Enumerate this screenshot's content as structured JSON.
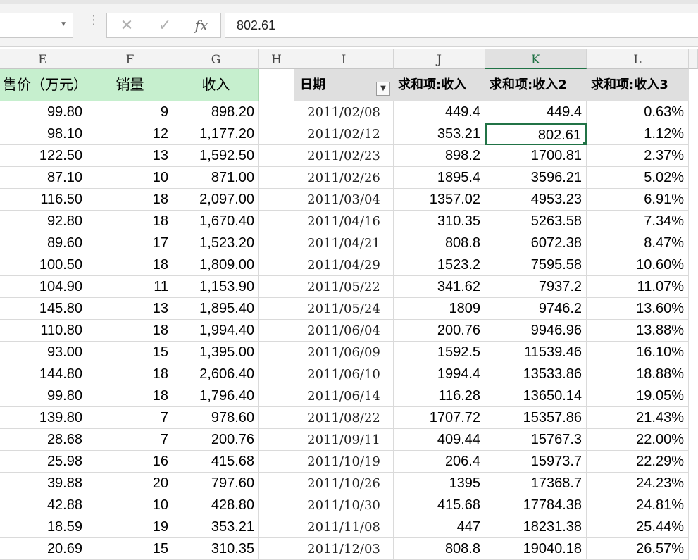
{
  "formula_bar": {
    "name_box_value": "",
    "formula_value": "802.61",
    "fx_label": "fx",
    "cancel_glyph": "✕",
    "enter_glyph": "✓",
    "menu_glyph": "⋮"
  },
  "columns": [
    "E",
    "F",
    "G",
    "H",
    "I",
    "J",
    "K",
    "L"
  ],
  "selected_column": "K",
  "headers": {
    "E": "售价（万元）",
    "F": "销量",
    "G": "收入",
    "I": "日期",
    "J": "求和项:收入",
    "K": "求和项:收入2",
    "L": "求和项:收入3"
  },
  "rows": [
    {
      "E": "99.80",
      "F": "9",
      "G": "898.20",
      "I": "2011/02/08",
      "J": "449.4",
      "K": "449.4",
      "L": "0.63%"
    },
    {
      "E": "98.10",
      "F": "12",
      "G": "1,177.20",
      "I": "2011/02/12",
      "J": "353.21",
      "K": "802.61",
      "L": "1.12%"
    },
    {
      "E": "122.50",
      "F": "13",
      "G": "1,592.50",
      "I": "2011/02/23",
      "J": "898.2",
      "K": "1700.81",
      "L": "2.37%"
    },
    {
      "E": "87.10",
      "F": "10",
      "G": "871.00",
      "I": "2011/02/26",
      "J": "1895.4",
      "K": "3596.21",
      "L": "5.02%"
    },
    {
      "E": "116.50",
      "F": "18",
      "G": "2,097.00",
      "I": "2011/03/04",
      "J": "1357.02",
      "K": "4953.23",
      "L": "6.91%"
    },
    {
      "E": "92.80",
      "F": "18",
      "G": "1,670.40",
      "I": "2011/04/16",
      "J": "310.35",
      "K": "5263.58",
      "L": "7.34%"
    },
    {
      "E": "89.60",
      "F": "17",
      "G": "1,523.20",
      "I": "2011/04/21",
      "J": "808.8",
      "K": "6072.38",
      "L": "8.47%"
    },
    {
      "E": "100.50",
      "F": "18",
      "G": "1,809.00",
      "I": "2011/04/29",
      "J": "1523.2",
      "K": "7595.58",
      "L": "10.60%"
    },
    {
      "E": "104.90",
      "F": "11",
      "G": "1,153.90",
      "I": "2011/05/22",
      "J": "341.62",
      "K": "7937.2",
      "L": "11.07%"
    },
    {
      "E": "145.80",
      "F": "13",
      "G": "1,895.40",
      "I": "2011/05/24",
      "J": "1809",
      "K": "9746.2",
      "L": "13.60%"
    },
    {
      "E": "110.80",
      "F": "18",
      "G": "1,994.40",
      "I": "2011/06/04",
      "J": "200.76",
      "K": "9946.96",
      "L": "13.88%"
    },
    {
      "E": "93.00",
      "F": "15",
      "G": "1,395.00",
      "I": "2011/06/09",
      "J": "1592.5",
      "K": "11539.46",
      "L": "16.10%"
    },
    {
      "E": "144.80",
      "F": "18",
      "G": "2,606.40",
      "I": "2011/06/10",
      "J": "1994.4",
      "K": "13533.86",
      "L": "18.88%"
    },
    {
      "E": "99.80",
      "F": "18",
      "G": "1,796.40",
      "I": "2011/06/14",
      "J": "116.28",
      "K": "13650.14",
      "L": "19.05%"
    },
    {
      "E": "139.80",
      "F": "7",
      "G": "978.60",
      "I": "2011/08/22",
      "J": "1707.72",
      "K": "15357.86",
      "L": "21.43%"
    },
    {
      "E": "28.68",
      "F": "7",
      "G": "200.76",
      "I": "2011/09/11",
      "J": "409.44",
      "K": "15767.3",
      "L": "22.00%"
    },
    {
      "E": "25.98",
      "F": "16",
      "G": "415.68",
      "I": "2011/10/19",
      "J": "206.4",
      "K": "15973.7",
      "L": "22.29%"
    },
    {
      "E": "39.88",
      "F": "20",
      "G": "797.60",
      "I": "2011/10/26",
      "J": "1395",
      "K": "17368.7",
      "L": "24.23%"
    },
    {
      "E": "42.88",
      "F": "10",
      "G": "428.80",
      "I": "2011/10/30",
      "J": "415.68",
      "K": "17784.38",
      "L": "24.81%"
    },
    {
      "E": "18.59",
      "F": "19",
      "G": "353.21",
      "I": "2011/11/08",
      "J": "447",
      "K": "18231.38",
      "L": "25.44%"
    },
    {
      "E": "20.69",
      "F": "15",
      "G": "310.35",
      "I": "2011/12/03",
      "J": "808.8",
      "K": "19040.18",
      "L": "26.57%"
    }
  ],
  "active_cell": {
    "row": 1,
    "col": "K"
  },
  "colors": {
    "header_green": "#c6efce",
    "pivot_header_gray": "#dfdfdf",
    "selection_green": "#217346"
  }
}
